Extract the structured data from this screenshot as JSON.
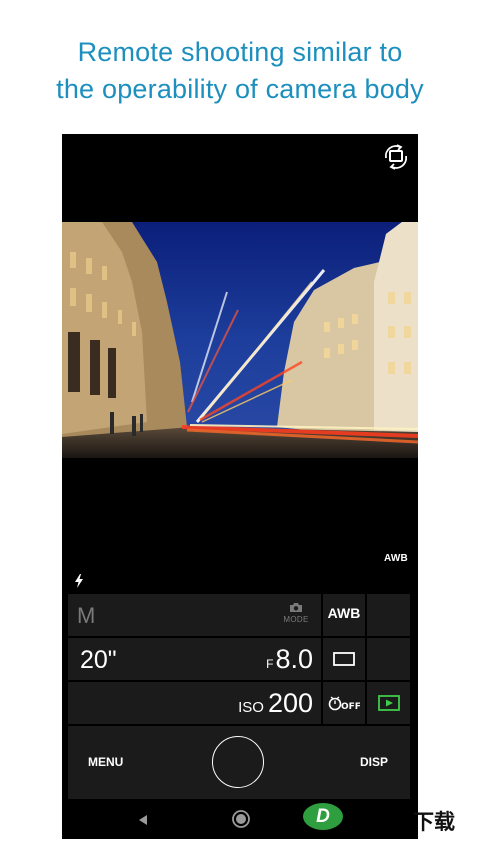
{
  "headline": {
    "line1": "Remote shooting similar to",
    "line2": "the operability of camera body"
  },
  "viewfinder": {
    "awb_indicator": "AWB",
    "flash_icon": "flash-icon",
    "rotate_icon": "rotate-camera-icon"
  },
  "settings": {
    "mode_letter": "M",
    "mode_label": "MODE",
    "shutter_speed": "20\"",
    "aperture_prefix": "F",
    "aperture_value": "8.0",
    "iso_label": "ISO",
    "iso_value": "200",
    "white_balance": "AWB",
    "drive_mode_icon": "single-shot-icon",
    "self_timer_icon": "self-timer-off-icon",
    "playback_icon": "playback-icon"
  },
  "controls": {
    "menu": "MENU",
    "disp": "DISP"
  },
  "watermark": {
    "logo_letter": "D",
    "text": "下载"
  },
  "colors": {
    "headline": "#1d8fbe",
    "panel": "#1b1b1b",
    "accent_green": "#3ecb4a"
  }
}
